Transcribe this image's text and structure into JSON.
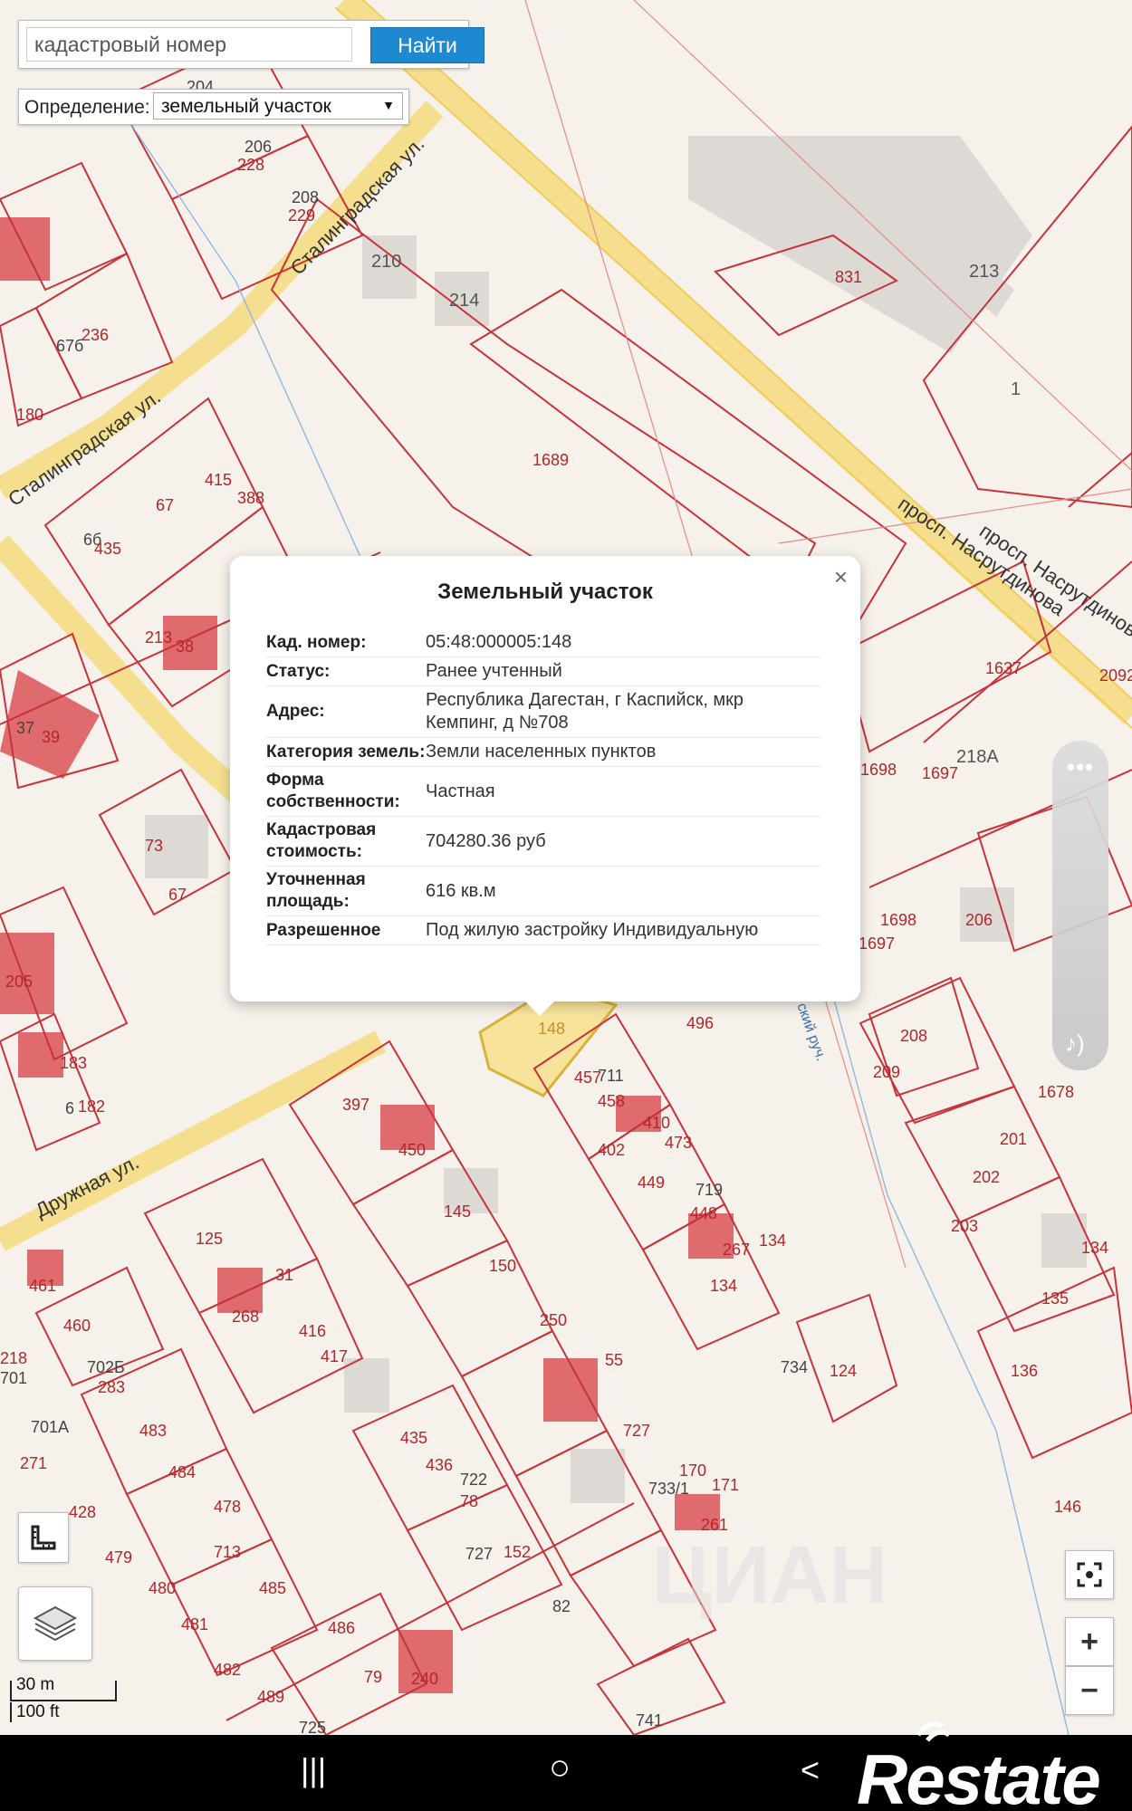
{
  "search": {
    "placeholder": "кадастровый номер",
    "button_label": "Найти"
  },
  "definition": {
    "label": "Определение:",
    "selected": "земельный участок"
  },
  "map": {
    "streets": [
      "Сталинградская ул.",
      "Сталинградская ул.",
      "просп. Насрутдинова",
      "просп. Насрутдинова",
      "Дружная ул.",
      "ский руч."
    ],
    "parcel_labels": [
      "206",
      "228",
      "208",
      "229",
      "210",
      "214",
      "204",
      "236",
      "67б",
      "180",
      "415",
      "388",
      "67",
      "6б",
      "435",
      "213",
      "38",
      "37",
      "39",
      "1689",
      "831",
      "213",
      "1",
      "73",
      "67",
      "205",
      "183",
      "182",
      "6",
      "1698",
      "1697",
      "218А",
      "1637",
      "2092",
      "1698",
      "1697",
      "206",
      "208",
      "209",
      "1678",
      "201",
      "202",
      "203",
      "134",
      "135",
      "136",
      "146",
      "397",
      "450",
      "145",
      "150",
      "250",
      "55",
      "727",
      "733/1",
      "170",
      "171",
      "261",
      "457",
      "711",
      "458",
      "410",
      "402",
      "473",
      "449",
      "719",
      "448",
      "267",
      "134",
      "134",
      "496",
      "124",
      "734",
      "125",
      "31",
      "268",
      "416",
      "417",
      "461",
      "460",
      "702Б",
      "283",
      "701",
      "218",
      "701А",
      "271",
      "428",
      "483",
      "484",
      "478",
      "713",
      "485",
      "486",
      "481",
      "482",
      "480",
      "479",
      "489",
      "79",
      "240",
      "725",
      "435",
      "436",
      "722",
      "78",
      "727",
      "152",
      "82",
      "741",
      "148"
    ]
  },
  "popup": {
    "title": "Земельный участок",
    "close": "×",
    "rows": [
      {
        "k": "Кад. номер:",
        "v": "05:48:000005:148"
      },
      {
        "k": "Статус:",
        "v": "Ранее учтенный"
      },
      {
        "k": "Адрес:",
        "v": "Республика Дагестан, г Каспийск, мкр Кемпинг, д №708"
      },
      {
        "k": "Категория земель:",
        "v": "Земли населенных пунктов"
      },
      {
        "k": "Форма собственности:",
        "v": "Частная"
      },
      {
        "k": "Кадастровая стоимость:",
        "v": "704280.36 руб"
      },
      {
        "k": "Уточненная площадь:",
        "v": "616 кв.м"
      },
      {
        "k": "Разрешенное",
        "v": "Под жилую застройку Индивидуальную"
      }
    ]
  },
  "tools": {
    "side_dots": "•••",
    "zoom_in": "+",
    "zoom_out": "−",
    "watermark": "ЦИАН"
  },
  "scale": {
    "metric": "30 m",
    "imperial": "100 ft"
  },
  "navbar": {
    "recent": "|||",
    "home": "○",
    "back": "<"
  },
  "logo_text": "Restate",
  "colors": {
    "parcel_line": "#c8323a",
    "road": "#f7e39a",
    "accent": "#1e88d0"
  }
}
